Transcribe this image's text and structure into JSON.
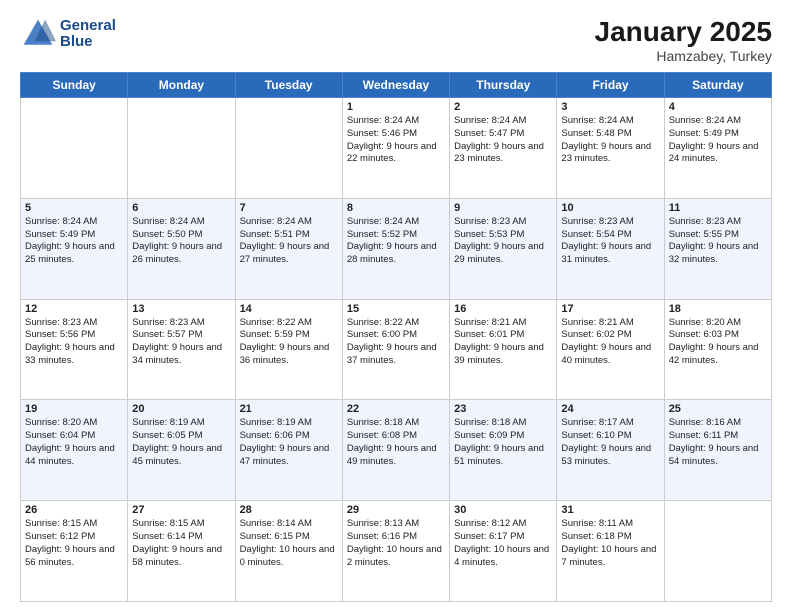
{
  "header": {
    "logo_line1": "General",
    "logo_line2": "Blue",
    "month": "January 2025",
    "location": "Hamzabey, Turkey"
  },
  "weekdays": [
    "Sunday",
    "Monday",
    "Tuesday",
    "Wednesday",
    "Thursday",
    "Friday",
    "Saturday"
  ],
  "weeks": [
    [
      {
        "day": "",
        "sunrise": "",
        "sunset": "",
        "daylight": ""
      },
      {
        "day": "",
        "sunrise": "",
        "sunset": "",
        "daylight": ""
      },
      {
        "day": "",
        "sunrise": "",
        "sunset": "",
        "daylight": ""
      },
      {
        "day": "1",
        "sunrise": "Sunrise: 8:24 AM",
        "sunset": "Sunset: 5:46 PM",
        "daylight": "Daylight: 9 hours and 22 minutes."
      },
      {
        "day": "2",
        "sunrise": "Sunrise: 8:24 AM",
        "sunset": "Sunset: 5:47 PM",
        "daylight": "Daylight: 9 hours and 23 minutes."
      },
      {
        "day": "3",
        "sunrise": "Sunrise: 8:24 AM",
        "sunset": "Sunset: 5:48 PM",
        "daylight": "Daylight: 9 hours and 23 minutes."
      },
      {
        "day": "4",
        "sunrise": "Sunrise: 8:24 AM",
        "sunset": "Sunset: 5:49 PM",
        "daylight": "Daylight: 9 hours and 24 minutes."
      }
    ],
    [
      {
        "day": "5",
        "sunrise": "Sunrise: 8:24 AM",
        "sunset": "Sunset: 5:49 PM",
        "daylight": "Daylight: 9 hours and 25 minutes."
      },
      {
        "day": "6",
        "sunrise": "Sunrise: 8:24 AM",
        "sunset": "Sunset: 5:50 PM",
        "daylight": "Daylight: 9 hours and 26 minutes."
      },
      {
        "day": "7",
        "sunrise": "Sunrise: 8:24 AM",
        "sunset": "Sunset: 5:51 PM",
        "daylight": "Daylight: 9 hours and 27 minutes."
      },
      {
        "day": "8",
        "sunrise": "Sunrise: 8:24 AM",
        "sunset": "Sunset: 5:52 PM",
        "daylight": "Daylight: 9 hours and 28 minutes."
      },
      {
        "day": "9",
        "sunrise": "Sunrise: 8:23 AM",
        "sunset": "Sunset: 5:53 PM",
        "daylight": "Daylight: 9 hours and 29 minutes."
      },
      {
        "day": "10",
        "sunrise": "Sunrise: 8:23 AM",
        "sunset": "Sunset: 5:54 PM",
        "daylight": "Daylight: 9 hours and 31 minutes."
      },
      {
        "day": "11",
        "sunrise": "Sunrise: 8:23 AM",
        "sunset": "Sunset: 5:55 PM",
        "daylight": "Daylight: 9 hours and 32 minutes."
      }
    ],
    [
      {
        "day": "12",
        "sunrise": "Sunrise: 8:23 AM",
        "sunset": "Sunset: 5:56 PM",
        "daylight": "Daylight: 9 hours and 33 minutes."
      },
      {
        "day": "13",
        "sunrise": "Sunrise: 8:23 AM",
        "sunset": "Sunset: 5:57 PM",
        "daylight": "Daylight: 9 hours and 34 minutes."
      },
      {
        "day": "14",
        "sunrise": "Sunrise: 8:22 AM",
        "sunset": "Sunset: 5:59 PM",
        "daylight": "Daylight: 9 hours and 36 minutes."
      },
      {
        "day": "15",
        "sunrise": "Sunrise: 8:22 AM",
        "sunset": "Sunset: 6:00 PM",
        "daylight": "Daylight: 9 hours and 37 minutes."
      },
      {
        "day": "16",
        "sunrise": "Sunrise: 8:21 AM",
        "sunset": "Sunset: 6:01 PM",
        "daylight": "Daylight: 9 hours and 39 minutes."
      },
      {
        "day": "17",
        "sunrise": "Sunrise: 8:21 AM",
        "sunset": "Sunset: 6:02 PM",
        "daylight": "Daylight: 9 hours and 40 minutes."
      },
      {
        "day": "18",
        "sunrise": "Sunrise: 8:20 AM",
        "sunset": "Sunset: 6:03 PM",
        "daylight": "Daylight: 9 hours and 42 minutes."
      }
    ],
    [
      {
        "day": "19",
        "sunrise": "Sunrise: 8:20 AM",
        "sunset": "Sunset: 6:04 PM",
        "daylight": "Daylight: 9 hours and 44 minutes."
      },
      {
        "day": "20",
        "sunrise": "Sunrise: 8:19 AM",
        "sunset": "Sunset: 6:05 PM",
        "daylight": "Daylight: 9 hours and 45 minutes."
      },
      {
        "day": "21",
        "sunrise": "Sunrise: 8:19 AM",
        "sunset": "Sunset: 6:06 PM",
        "daylight": "Daylight: 9 hours and 47 minutes."
      },
      {
        "day": "22",
        "sunrise": "Sunrise: 8:18 AM",
        "sunset": "Sunset: 6:08 PM",
        "daylight": "Daylight: 9 hours and 49 minutes."
      },
      {
        "day": "23",
        "sunrise": "Sunrise: 8:18 AM",
        "sunset": "Sunset: 6:09 PM",
        "daylight": "Daylight: 9 hours and 51 minutes."
      },
      {
        "day": "24",
        "sunrise": "Sunrise: 8:17 AM",
        "sunset": "Sunset: 6:10 PM",
        "daylight": "Daylight: 9 hours and 53 minutes."
      },
      {
        "day": "25",
        "sunrise": "Sunrise: 8:16 AM",
        "sunset": "Sunset: 6:11 PM",
        "daylight": "Daylight: 9 hours and 54 minutes."
      }
    ],
    [
      {
        "day": "26",
        "sunrise": "Sunrise: 8:15 AM",
        "sunset": "Sunset: 6:12 PM",
        "daylight": "Daylight: 9 hours and 56 minutes."
      },
      {
        "day": "27",
        "sunrise": "Sunrise: 8:15 AM",
        "sunset": "Sunset: 6:14 PM",
        "daylight": "Daylight: 9 hours and 58 minutes."
      },
      {
        "day": "28",
        "sunrise": "Sunrise: 8:14 AM",
        "sunset": "Sunset: 6:15 PM",
        "daylight": "Daylight: 10 hours and 0 minutes."
      },
      {
        "day": "29",
        "sunrise": "Sunrise: 8:13 AM",
        "sunset": "Sunset: 6:16 PM",
        "daylight": "Daylight: 10 hours and 2 minutes."
      },
      {
        "day": "30",
        "sunrise": "Sunrise: 8:12 AM",
        "sunset": "Sunset: 6:17 PM",
        "daylight": "Daylight: 10 hours and 4 minutes."
      },
      {
        "day": "31",
        "sunrise": "Sunrise: 8:11 AM",
        "sunset": "Sunset: 6:18 PM",
        "daylight": "Daylight: 10 hours and 7 minutes."
      },
      {
        "day": "",
        "sunrise": "",
        "sunset": "",
        "daylight": ""
      }
    ]
  ]
}
